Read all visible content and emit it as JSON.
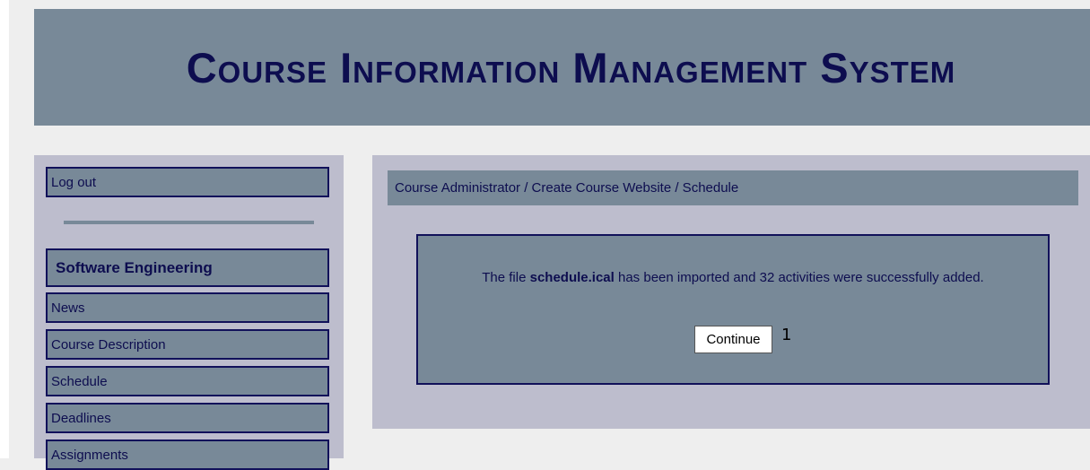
{
  "header": {
    "title": "Course Information Management System"
  },
  "sidebar": {
    "logout": "Log out",
    "course_heading": "Software Engineering",
    "items": [
      {
        "label": "News"
      },
      {
        "label": "Course Description"
      },
      {
        "label": "Schedule"
      },
      {
        "label": "Deadlines"
      },
      {
        "label": "Assignments"
      }
    ]
  },
  "main": {
    "breadcrumb": "Course Administrator / Create Course Website / Schedule",
    "message": {
      "prefix": "The file ",
      "filename": "schedule.ical",
      "suffix": " has been imported and 32 activities were successfully added."
    },
    "continue_label": "Continue",
    "marker": "1"
  },
  "colors": {
    "page_background": "#eeeeee",
    "panel_background": "#bdbdcd",
    "accent_slate": "#788998",
    "text_navy": "#0d0d4f",
    "border_navy": "#11115a"
  }
}
